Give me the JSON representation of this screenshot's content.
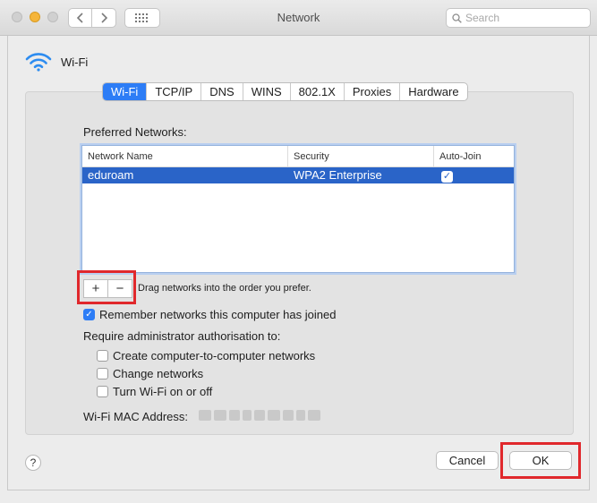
{
  "window": {
    "title": "Network",
    "search_placeholder": "Search"
  },
  "header": {
    "interface_name": "Wi-Fi"
  },
  "tabs": [
    {
      "label": "Wi-Fi",
      "active": true
    },
    {
      "label": "TCP/IP",
      "active": false
    },
    {
      "label": "DNS",
      "active": false
    },
    {
      "label": "WINS",
      "active": false
    },
    {
      "label": "802.1X",
      "active": false
    },
    {
      "label": "Proxies",
      "active": false
    },
    {
      "label": "Hardware",
      "active": false
    }
  ],
  "preferred": {
    "label": "Preferred Networks:",
    "columns": [
      "Network Name",
      "Security",
      "Auto-Join"
    ],
    "rows": [
      {
        "name": "eduroam",
        "security": "WPA2 Enterprise",
        "auto_join": true
      }
    ],
    "add_symbol": "+",
    "remove_symbol": "−",
    "drag_hint": "Drag networks into the order you prefer."
  },
  "options": {
    "remember": {
      "label": "Remember networks this computer has joined",
      "checked": true
    },
    "require_label": "Require administrator authorisation to:",
    "create": {
      "label": "Create computer-to-computer networks",
      "checked": false
    },
    "change": {
      "label": "Change networks",
      "checked": false
    },
    "turn": {
      "label": "Turn Wi-Fi on or off",
      "checked": false
    }
  },
  "mac": {
    "label": "Wi-Fi MAC Address:"
  },
  "footer": {
    "help_symbol": "?",
    "cancel_label": "Cancel",
    "ok_label": "OK"
  },
  "colors": {
    "accent": "#2d7df6",
    "selection": "#2a64c8",
    "highlight": "#e0282c"
  }
}
